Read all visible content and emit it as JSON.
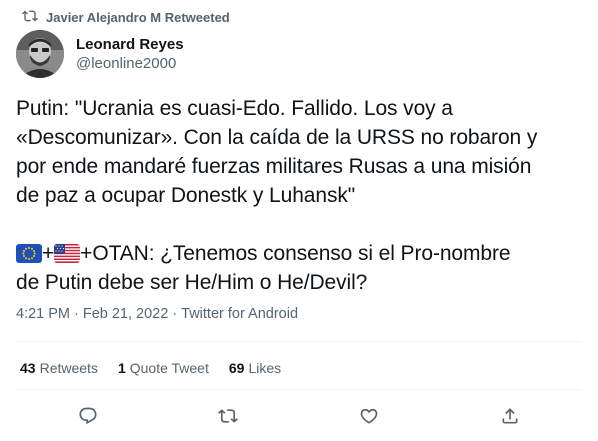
{
  "retweet_context": {
    "icon": "retweet-icon",
    "text": "Javier Alejandro M Retweeted"
  },
  "author": {
    "display_name": "Leonard Reyes",
    "handle": "@leonline2000",
    "avatar": "avatar-image"
  },
  "tweet": {
    "lines": [
      "Putin: \"Ucrania es cuasi-Edo. Fallido. Los voy a",
      "«Descomunizar». Con la caída de la URSS no robaron y",
      "por ende mandaré fuerzas militares Rusas a una misión",
      "de paz a ocupar Donestk y Luhansk\""
    ],
    "flag_line_parts": [
      "+",
      "+OTAN: ¿Tenemos consenso si el Pro-nombre"
    ],
    "flag_icons": [
      "eu-flag-icon",
      "us-flag-icon"
    ],
    "last_line": "de Putin debe ser He/Him o He/Devil?"
  },
  "timestamp": {
    "time": "4:21 PM",
    "sep1": "·",
    "date": "Feb 21, 2022",
    "sep2": "·",
    "source": "Twitter for Android"
  },
  "stats": [
    {
      "count": "43",
      "label": "Retweets"
    },
    {
      "count": "1",
      "label": "Quote Tweet"
    },
    {
      "count": "69",
      "label": "Likes"
    }
  ],
  "actions": [
    "reply-icon",
    "retweet-icon",
    "like-icon",
    "share-icon"
  ],
  "colors": {
    "text": "#0f1419",
    "secondary": "#536471",
    "divider": "#eff3f4"
  }
}
